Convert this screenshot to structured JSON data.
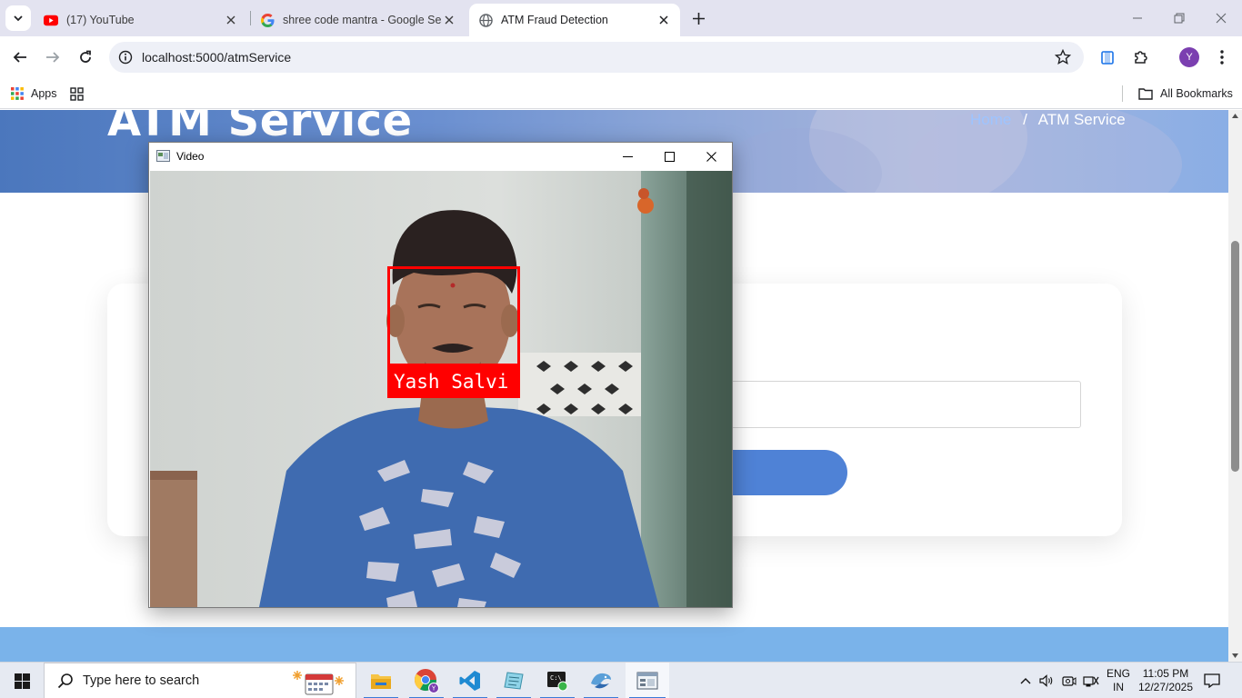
{
  "browser": {
    "tabs": [
      {
        "title": "(17) YouTube",
        "favicon": "youtube-icon",
        "active": false
      },
      {
        "title": "shree code mantra - Google Search",
        "favicon": "google-icon",
        "active": false
      },
      {
        "title": "ATM Fraud Detection",
        "favicon": "globe-icon",
        "active": true
      }
    ],
    "url": "localhost:5000/atmService",
    "profile_initial": "Y",
    "bookmarks": {
      "apps_label": "Apps",
      "all_bookmarks_label": "All Bookmarks"
    }
  },
  "page": {
    "hero_title": "ATM Service",
    "breadcrumb": {
      "home": "Home",
      "separator": "/",
      "current": "ATM Service"
    },
    "colors": {
      "hero": "#4b77bd",
      "button": "#4f82d6",
      "footer": "#7ab3ea"
    }
  },
  "video_window": {
    "title": "Video",
    "detected_name": "Yash Salvi",
    "box_color": "#ff0000"
  },
  "taskbar": {
    "search_placeholder": "Type here to search",
    "apps": [
      "file-explorer-icon",
      "chrome-icon",
      "vscode-icon",
      "notepad-icon",
      "terminal-icon",
      "python-icon",
      "video-window-icon"
    ],
    "language_top": "ENG",
    "language_bottom": "IN",
    "time": "11:05 PM",
    "date": "12/27/2025"
  }
}
